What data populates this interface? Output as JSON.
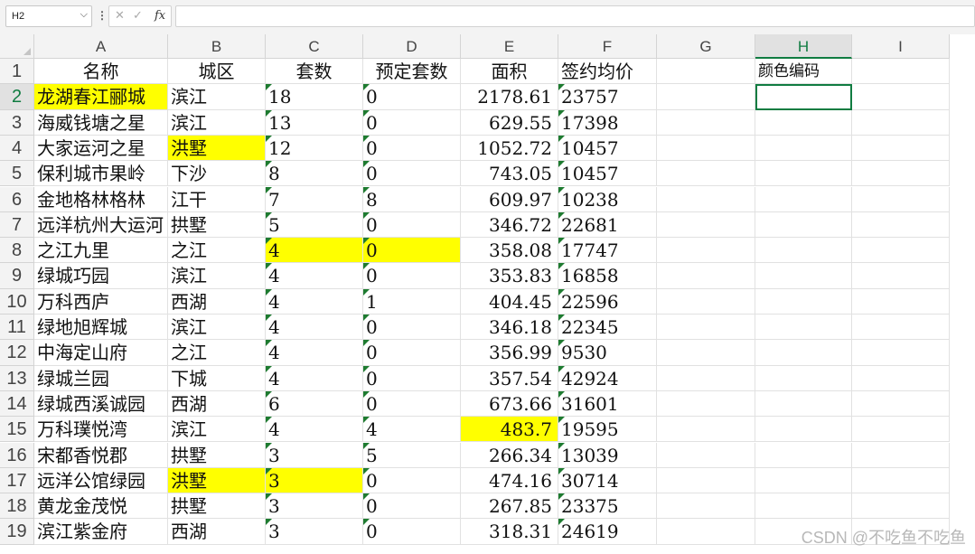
{
  "formula_bar": {
    "name_box": "H2",
    "chevron_icon": "chevron-down-icon",
    "separator": "⋮",
    "cancel_icon": "✕",
    "enter_icon": "✓",
    "fx_label": "fx",
    "formula": ""
  },
  "columns": [
    "A",
    "B",
    "C",
    "D",
    "E",
    "F",
    "G",
    "H",
    "I"
  ],
  "rows": [
    "1",
    "2",
    "3",
    "4",
    "5",
    "6",
    "7",
    "8",
    "9",
    "10",
    "11",
    "12",
    "13",
    "14",
    "15",
    "16",
    "17",
    "18",
    "19"
  ],
  "header_row": [
    "名称",
    "城区",
    "套数",
    "预定套数",
    "面积",
    "签约均价",
    "",
    "颜色编码",
    ""
  ],
  "data_rows": [
    [
      "龙湖春江郦城",
      "滨江",
      "18",
      "0",
      "2178.61",
      "23757"
    ],
    [
      "海威钱塘之星",
      "滨江",
      "13",
      "0",
      "629.55",
      "17398"
    ],
    [
      "大家运河之星",
      "洪墅",
      "12",
      "0",
      "1052.72",
      "10457"
    ],
    [
      "保利城市果岭",
      "下沙",
      "8",
      "0",
      "743.05",
      "10457"
    ],
    [
      "金地格林格林",
      "江干",
      "7",
      "8",
      "609.97",
      "10238"
    ],
    [
      "远洋杭州大运河",
      "拱墅",
      "5",
      "0",
      "346.72",
      "22681"
    ],
    [
      "之江九里",
      "之江",
      "4",
      "0",
      "358.08",
      "17747"
    ],
    [
      "绿城巧园",
      "滨江",
      "4",
      "0",
      "353.83",
      "16858"
    ],
    [
      "万科西庐",
      "西湖",
      "4",
      "1",
      "404.45",
      "22596"
    ],
    [
      "绿地旭辉城",
      "滨江",
      "4",
      "0",
      "346.18",
      "22345"
    ],
    [
      "中海定山府",
      "之江",
      "4",
      "0",
      "356.99",
      "9530"
    ],
    [
      "绿城兰园",
      "下城",
      "4",
      "0",
      "357.54",
      "42924"
    ],
    [
      "绿城西溪诚园",
      "西湖",
      "6",
      "0",
      "673.66",
      "31601"
    ],
    [
      "万科璞悦湾",
      "滨江",
      "4",
      "4",
      "483.7",
      "19595"
    ],
    [
      "宋都香悦郡",
      "拱墅",
      "3",
      "5",
      "266.34",
      "13039"
    ],
    [
      "远洋公馆绿园",
      "洪墅",
      "3",
      "0",
      "474.16",
      "30714"
    ],
    [
      "黄龙金茂悦",
      "拱墅",
      "3",
      "0",
      "267.85",
      "23375"
    ],
    [
      "滨江紫金府",
      "西湖",
      "3",
      "0",
      "318.31",
      "24619"
    ]
  ],
  "highlight_color": "#ffff00",
  "watermark": "CSDN @不吃鱼不吃鱼"
}
